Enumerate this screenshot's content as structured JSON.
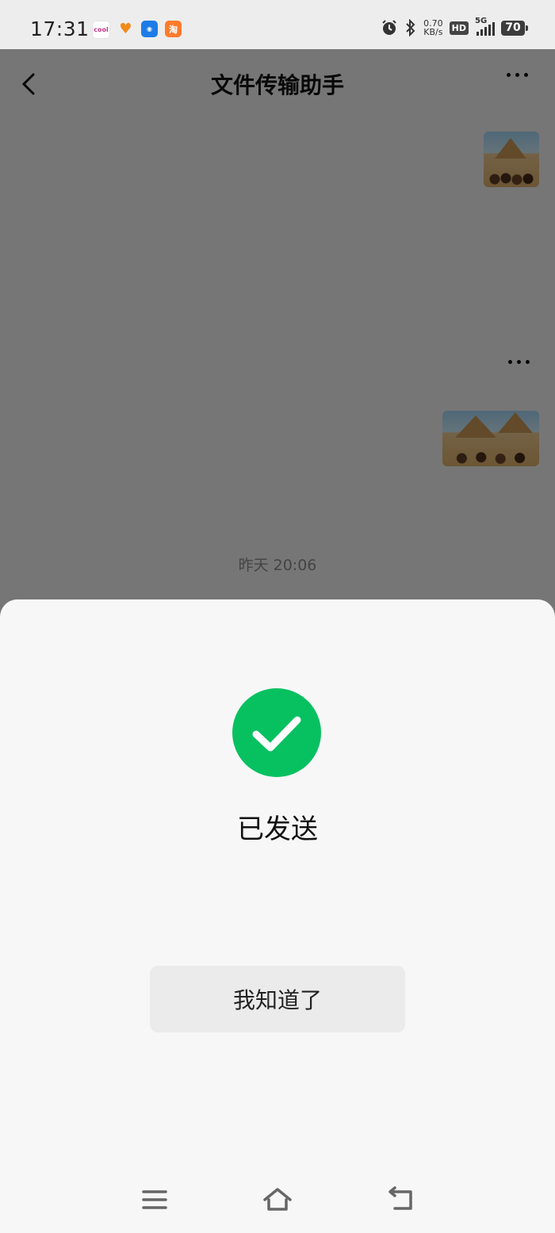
{
  "status_bar": {
    "time": "17:31",
    "app_icons": [
      {
        "name": "cool-app-icon",
        "text": "cool"
      },
      {
        "name": "heart-app-icon",
        "text": "♥"
      },
      {
        "name": "robot-app-icon",
        "text": "◉"
      },
      {
        "name": "taobao-app-icon",
        "text": "淘"
      }
    ],
    "net_speed_value": "0.70",
    "net_speed_unit": "KB/s",
    "hd": "HD",
    "network": "5G",
    "battery": "70"
  },
  "chat": {
    "title": "文件传输助手",
    "timestamp": "昨天 20:06"
  },
  "sheet": {
    "message": "已发送",
    "button_label": "我知道了"
  },
  "colors": {
    "success": "#07c160",
    "overlay": "rgba(0,0,0,0.5)",
    "sheet_bg": "#f7f7f7"
  }
}
